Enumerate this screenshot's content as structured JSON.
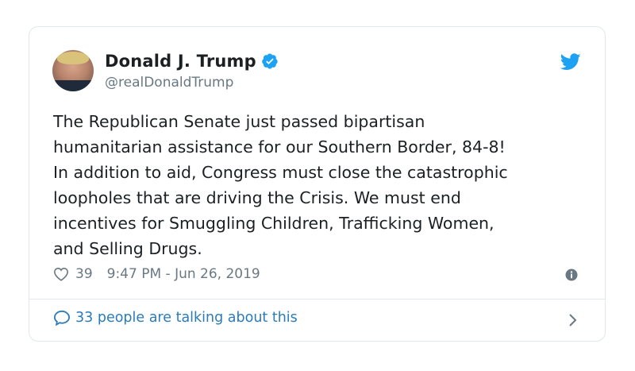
{
  "tweet": {
    "author_name": "Donald J. Trump",
    "author_handle": "@realDonaldTrump",
    "text": "The Republican Senate just passed bipartisan\nhumanitarian assistance for our Southern Border, 84-8!\nIn addition to aid, Congress must close the catastrophic\nloopholes that are driving the Crisis. We must end\nincentives for Smuggling Children, Trafficking Women,\nand Selling Drugs.",
    "likes": "39",
    "timestamp": "9:47 PM - Jun 26, 2019",
    "talking_text": "33 people are talking about this"
  },
  "icons": {
    "verified": "verified-badge-icon",
    "bird": "twitter-bird-icon",
    "heart": "heart-icon",
    "info": "info-icon",
    "bubble": "speech-bubble-icon",
    "chevron": "chevron-right-icon"
  },
  "colors": {
    "accent": "#1da1f2",
    "link": "#2b7bb9",
    "muted": "#697882",
    "text": "#1c2022",
    "border": "#e1e8ed"
  }
}
